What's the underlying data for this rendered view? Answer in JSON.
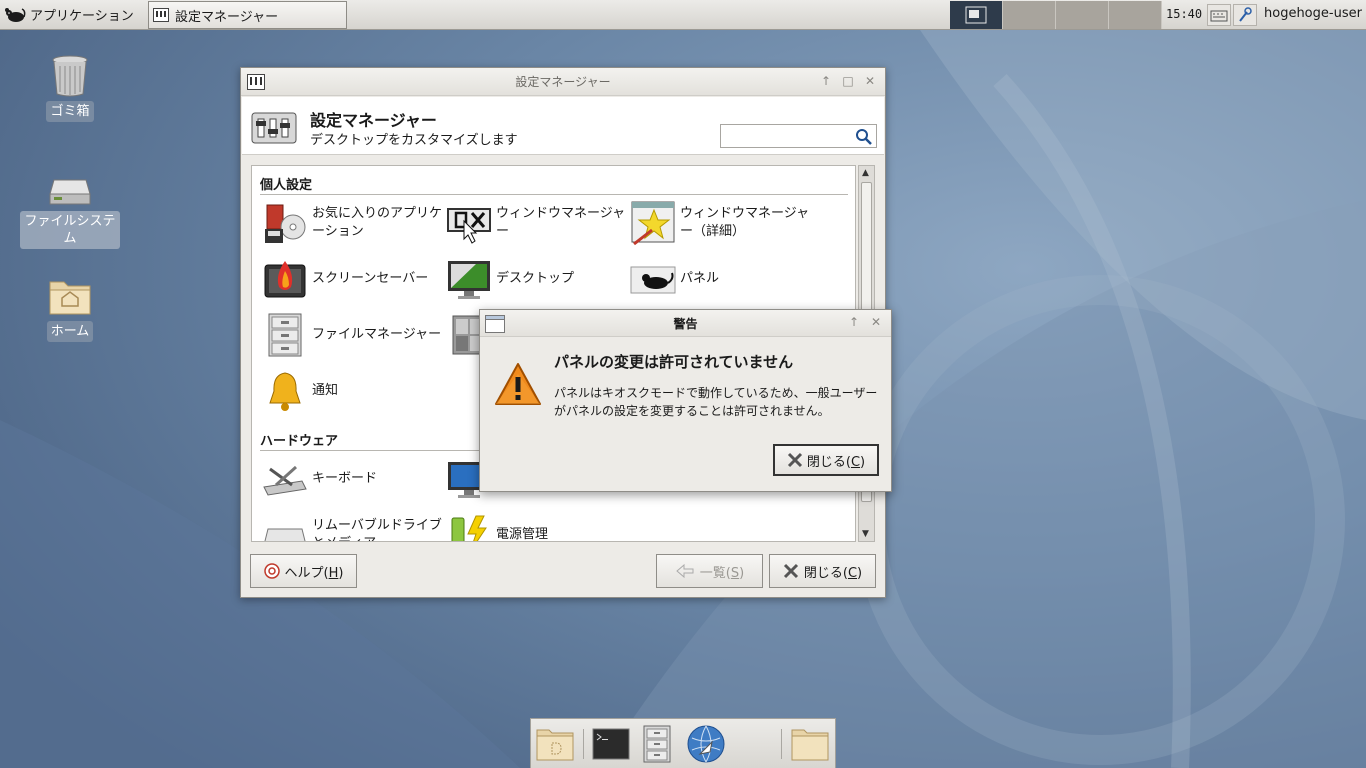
{
  "top_panel": {
    "apps_menu_label": "アプリケーション",
    "task_label": "設定マネージャー",
    "clock": "15:40",
    "username": "hogehoge-user",
    "workspaces": 4
  },
  "desktop": {
    "trash_label": "ゴミ箱",
    "filesystem_label": "ファイルシステム",
    "home_label": "ホーム"
  },
  "settings": {
    "window_title": "設定マネージャー",
    "header_title": "設定マネージャー",
    "header_subtitle": "デスクトップをカスタマイズします",
    "search_placeholder": "",
    "sections": {
      "personal": "個人設定",
      "hardware": "ハードウェア"
    },
    "items": {
      "preferred_apps": "お気に入りのアプリケーション",
      "window_manager": "ウィンドウマネージャー",
      "window_manager_tweaks": "ウィンドウマネージャー（詳細）",
      "screensaver": "スクリーンセーバー",
      "desktop": "デスクトップ",
      "panel": "パネル",
      "file_manager": "ファイルマネージャー",
      "notifications": "通知",
      "keyboard": "キーボード",
      "removable": "リムーバブルドライブとメディア",
      "power": "電源管理"
    },
    "help_label": "ヘルプ(",
    "help_mnemonic": "H",
    "all_label": "一覧(",
    "all_mnemonic": "S",
    "close_label": "閉じる(",
    "close_mnemonic": "C",
    "paren_close": ")"
  },
  "warning": {
    "title": "警告",
    "heading": "パネルの変更は許可されていません",
    "message": "パネルはキオスクモードで動作しているため、一般ユーザーがパネルの設定を変更することは許可されません。",
    "close_label": "閉じる(",
    "close_mnemonic": "C",
    "paren_close": ")"
  },
  "colors": {
    "desktop_bg": "#4f6b8c",
    "panel_bg": "#dcdad5",
    "active_workspace": "#2e3b4b",
    "warning_orange": "#f08a1c"
  }
}
